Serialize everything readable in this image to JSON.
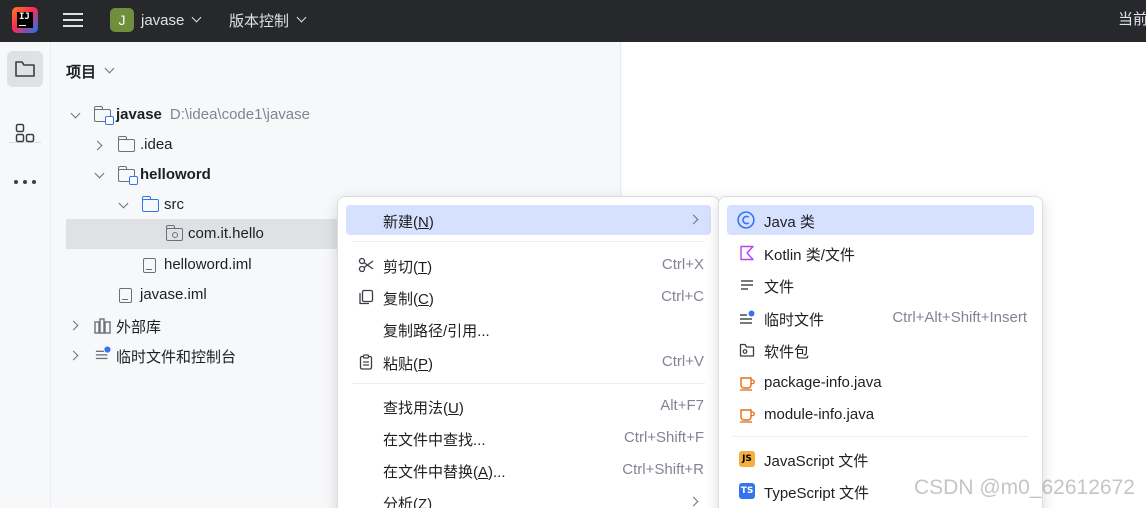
{
  "titlebar": {
    "project_badge": "J",
    "project_name": "javase",
    "vcs_label": "版本控制",
    "current_partial": "当前"
  },
  "panel": {
    "title": "项目"
  },
  "tree": {
    "root_label": "javase",
    "root_path": "D:\\idea\\code1\\javase",
    "idea": ".idea",
    "helloword": "helloword",
    "src": "src",
    "package": "com.it.hello",
    "helloword_iml": "helloword.iml",
    "javase_iml": "javase.iml",
    "external_libs": "外部库",
    "scratches": "临时文件和控制台"
  },
  "menu": {
    "new": {
      "label": "新建(",
      "mn": "N",
      "tail": ")"
    },
    "cut": {
      "label": "剪切(",
      "mn": "T",
      "tail": ")",
      "shortcut": "Ctrl+X"
    },
    "copy": {
      "label": "复制(",
      "mn": "C",
      "tail": ")",
      "shortcut": "Ctrl+C"
    },
    "copy_path": {
      "label": "复制路径/引用..."
    },
    "paste": {
      "label": "粘贴(",
      "mn": "P",
      "tail": ")",
      "shortcut": "Ctrl+V"
    },
    "find_usages": {
      "label": "查找用法(",
      "mn": "U",
      "tail": ")",
      "shortcut": "Alt+F7"
    },
    "find_in_files": {
      "label": "在文件中查找...",
      "shortcut": "Ctrl+Shift+F"
    },
    "replace_in_files": {
      "label": "在文件中替换(",
      "mn": "A",
      "tail": ")...",
      "shortcut": "Ctrl+Shift+R"
    },
    "analyze": {
      "label": "分析(",
      "mn": "Z",
      "tail": ")"
    }
  },
  "submenu": {
    "java_class": "Java 类",
    "kotlin": "Kotlin 类/文件",
    "file": "文件",
    "scratch": "临时文件",
    "scratch_shortcut": "Ctrl+Alt+Shift+Insert",
    "package": "软件包",
    "package_info": "package-info.java",
    "module_info": "module-info.java",
    "javascript": "JavaScript 文件",
    "typescript": "TypeScript 文件",
    "js_badge": "JS",
    "ts_badge": "TS"
  },
  "watermark": "CSDN @m0_62612672",
  "colors": {
    "titlebar_bg": "#27282c",
    "highlight": "#d5e1ff",
    "selection": "#dfe1e5",
    "accent_blue": "#3574f0",
    "java_orange": "#e66d17"
  }
}
